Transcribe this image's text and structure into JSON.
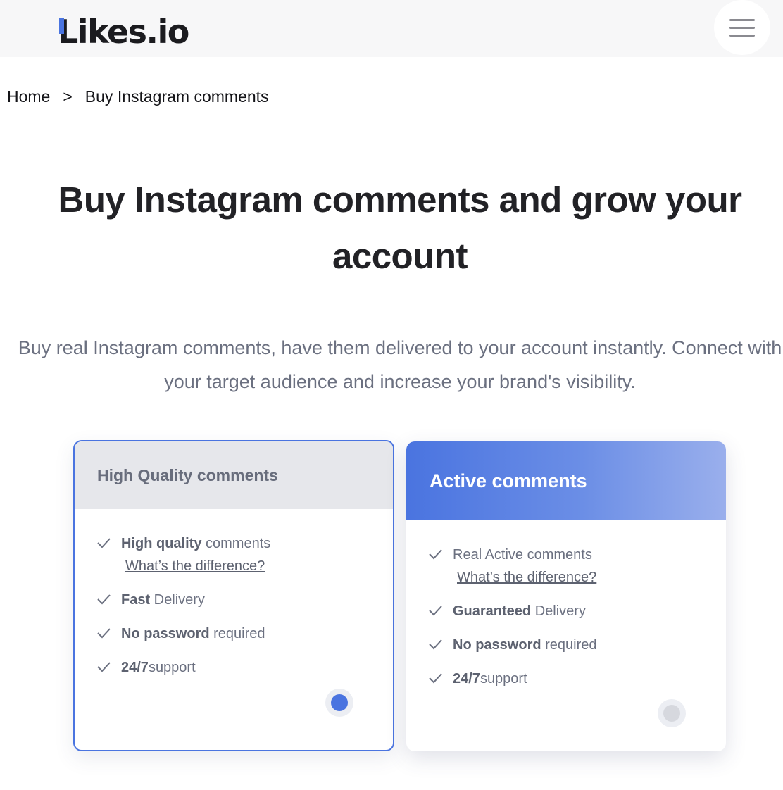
{
  "header": {
    "logo_text": "Likes.io",
    "menu_icon": "hamburger-menu-icon"
  },
  "breadcrumb": {
    "home": "Home",
    "separator": ">",
    "current": "Buy Instagram comments"
  },
  "hero": {
    "title": "Buy Instagram comments and grow your account",
    "subtitle": "Buy real Instagram comments, have them delivered to your account instantly. Connect with your target audience and increase your brand's visibility."
  },
  "cards": [
    {
      "title": "High Quality comments",
      "selected": true,
      "features": [
        {
          "bold": "High quality",
          "text": " comments",
          "link": "What’s the difference?"
        },
        {
          "bold": "Fast",
          "text": " Delivery"
        },
        {
          "bold": "No password",
          "text": " required"
        },
        {
          "bold": "24/7",
          "text": "support"
        }
      ]
    },
    {
      "title": "Active comments",
      "selected": false,
      "features": [
        {
          "bold": "",
          "text": "Real Active comments",
          "link": "What’s the difference?"
        },
        {
          "bold": "Guaranteed",
          "text": " Delivery"
        },
        {
          "bold": "No password",
          "text": " required"
        },
        {
          "bold": "24/7",
          "text": "support"
        }
      ]
    }
  ],
  "colors": {
    "accent": "#4a74e0",
    "text_muted": "#6b7080",
    "header_bg": "#f7f7f8",
    "card_head_hq": "#e6e7eb"
  }
}
